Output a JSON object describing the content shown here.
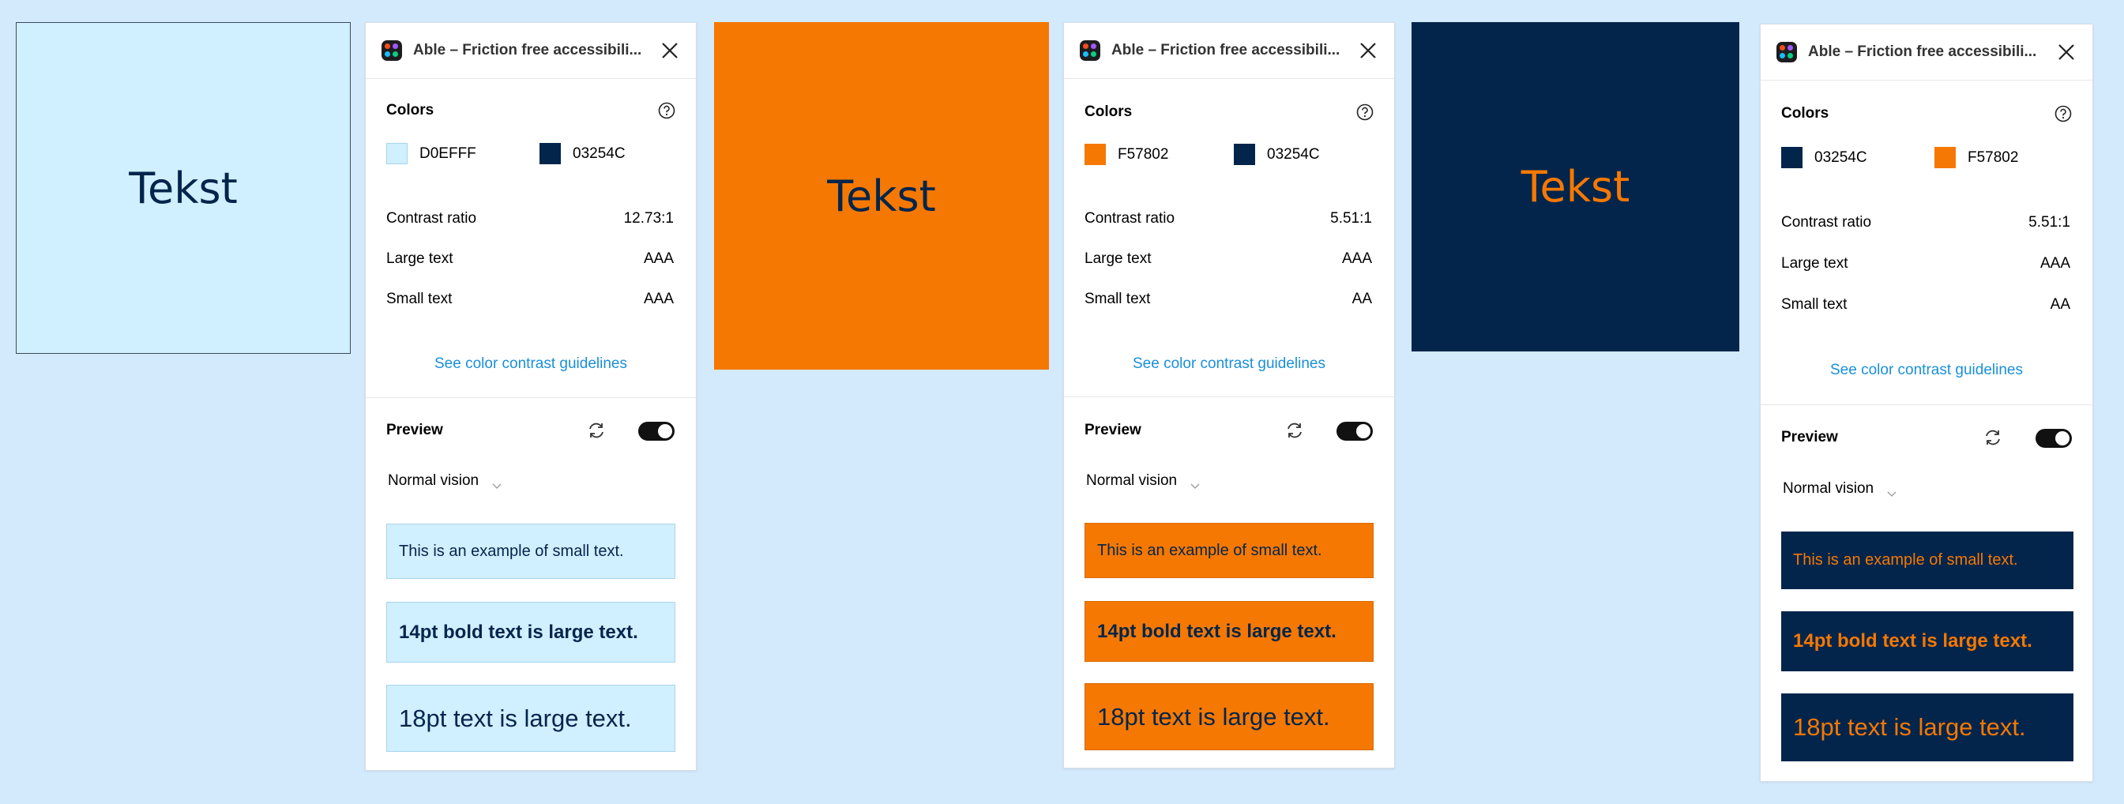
{
  "swatches": [
    {
      "text": "Tekst",
      "background": "#D0EFFF",
      "color": "#03254C"
    },
    {
      "text": "Tekst",
      "background": "#F57802",
      "color": "#03254C"
    },
    {
      "text": "Tekst",
      "background": "#03254C",
      "color": "#F57802"
    }
  ],
  "panels": [
    {
      "title": "Able – Friction free accessibili...",
      "colors_label": "Colors",
      "color1": {
        "hex": "D0EFFF",
        "swatch": "#D0EFFF"
      },
      "color2": {
        "hex": "03254C",
        "swatch": "#03254C"
      },
      "rows": [
        {
          "label": "Contrast ratio",
          "value": "12.73:1"
        },
        {
          "label": "Large text",
          "value": "AAA"
        },
        {
          "label": "Small text",
          "value": "AAA"
        }
      ],
      "link": "See color contrast guidelines",
      "preview_label": "Preview",
      "vision": "Normal vision",
      "preview_bg": "#D0EFFF",
      "preview_fg": "#03254C",
      "samples": {
        "small": "This is an example of small text.",
        "bold": "14pt bold text is large text.",
        "large": "18pt text is large text."
      }
    },
    {
      "title": "Able – Friction free accessibili...",
      "colors_label": "Colors",
      "color1": {
        "hex": "F57802",
        "swatch": "#F57802"
      },
      "color2": {
        "hex": "03254C",
        "swatch": "#03254C"
      },
      "rows": [
        {
          "label": "Contrast ratio",
          "value": "5.51:1"
        },
        {
          "label": "Large text",
          "value": "AAA"
        },
        {
          "label": "Small text",
          "value": "AA"
        }
      ],
      "link": "See color contrast guidelines",
      "preview_label": "Preview",
      "vision": "Normal vision",
      "preview_bg": "#F57802",
      "preview_fg": "#03254C",
      "samples": {
        "small": "This is an example of small text.",
        "bold": "14pt bold text is large text.",
        "large": "18pt text is large text."
      }
    },
    {
      "title": "Able – Friction free accessibili...",
      "colors_label": "Colors",
      "color1": {
        "hex": "03254C",
        "swatch": "#03254C"
      },
      "color2": {
        "hex": "F57802",
        "swatch": "#F57802"
      },
      "rows": [
        {
          "label": "Contrast ratio",
          "value": "5.51:1"
        },
        {
          "label": "Large text",
          "value": "AAA"
        },
        {
          "label": "Small text",
          "value": "AA"
        }
      ],
      "link": "See color contrast guidelines",
      "preview_label": "Preview",
      "vision": "Normal vision",
      "preview_bg": "#03254C",
      "preview_fg": "#F57802",
      "samples": {
        "small": "This is an example of small text.",
        "bold": "14pt bold text is large text.",
        "large": "18pt text is large text."
      }
    }
  ]
}
